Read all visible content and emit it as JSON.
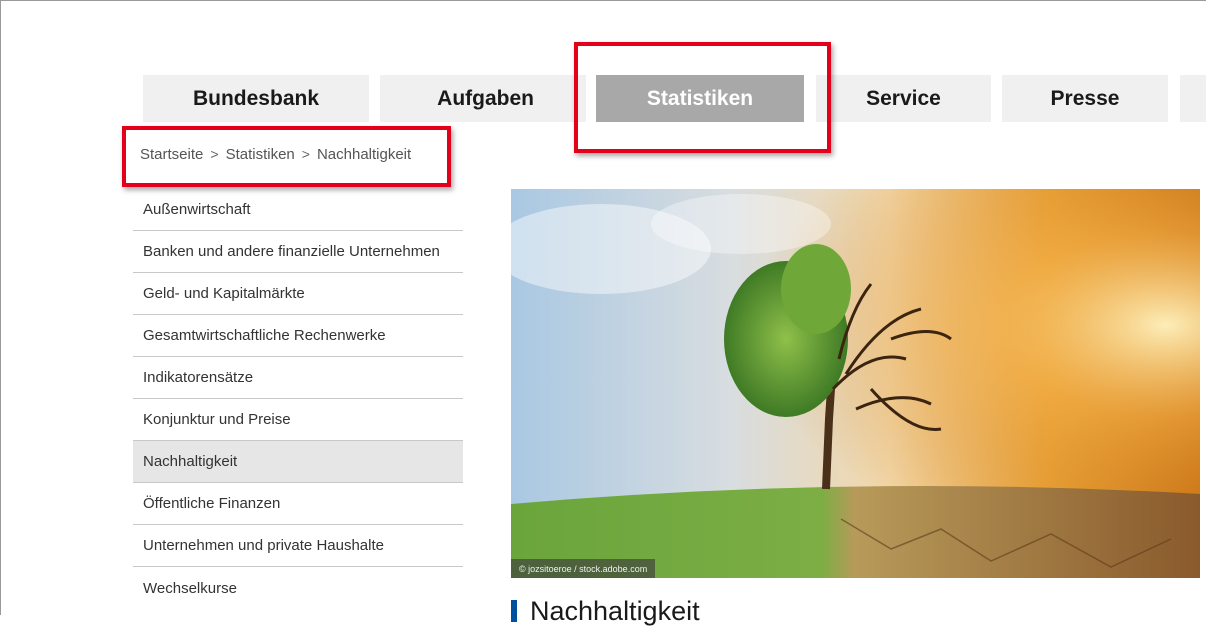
{
  "nav": {
    "items": [
      {
        "label": "Bundesbank"
      },
      {
        "label": "Aufgaben"
      },
      {
        "label": "Statistiken"
      },
      {
        "label": "Service"
      },
      {
        "label": "Presse"
      },
      {
        "label": ""
      }
    ],
    "active": "Statistiken"
  },
  "breadcrumb": {
    "items": [
      "Startseite",
      "Statistiken",
      "Nachhaltigkeit"
    ],
    "separator": ">"
  },
  "sidebar": {
    "items": [
      {
        "label": "Außenwirtschaft"
      },
      {
        "label": "Banken und andere finanzielle Unternehmen"
      },
      {
        "label": "Geld- und Kapitalmärkte"
      },
      {
        "label": "Gesamtwirtschaftliche Rechenwerke"
      },
      {
        "label": "Indikatorensätze"
      },
      {
        "label": "Konjunktur und Preise"
      },
      {
        "label": "Nachhaltigkeit"
      },
      {
        "label": "Öffentliche Finanzen"
      },
      {
        "label": "Unternehmen und private Haushalte"
      },
      {
        "label": "Wechselkurse"
      }
    ],
    "active": "Nachhaltigkeit"
  },
  "hero": {
    "credit": "© jozsitoeroe / stock.adobe.com"
  },
  "content": {
    "heading": "Nachhaltigkeit"
  },
  "colors": {
    "highlight": "#e3001b",
    "active_nav": "#a8a8a8",
    "accent": "#0050a0"
  }
}
